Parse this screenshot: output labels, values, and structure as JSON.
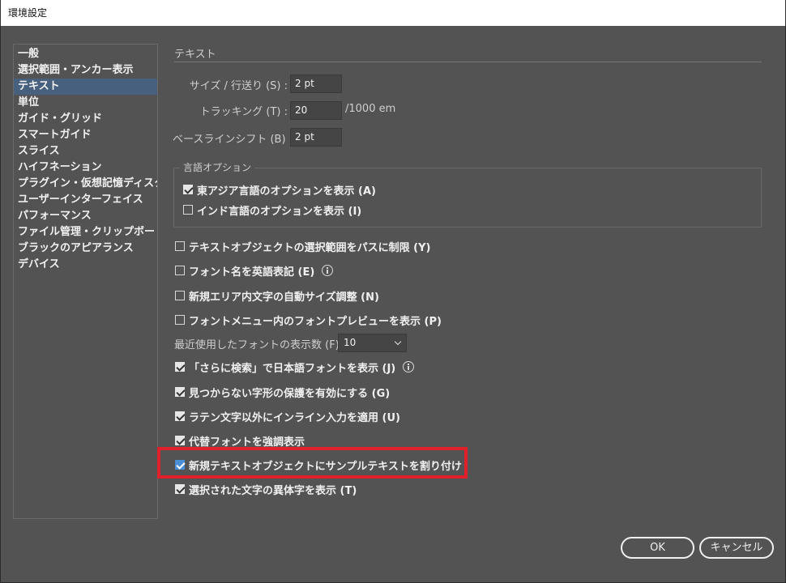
{
  "window": {
    "title": "環境設定"
  },
  "sidebar": {
    "items": [
      {
        "label": "一般",
        "selected": false
      },
      {
        "label": "選択範囲・アンカー表示",
        "selected": false
      },
      {
        "label": "テキスト",
        "selected": true
      },
      {
        "label": "単位",
        "selected": false
      },
      {
        "label": "ガイド・グリッド",
        "selected": false
      },
      {
        "label": "スマートガイド",
        "selected": false
      },
      {
        "label": "スライス",
        "selected": false
      },
      {
        "label": "ハイフネーション",
        "selected": false
      },
      {
        "label": "プラグイン・仮想記憶ディスク",
        "selected": false
      },
      {
        "label": "ユーザーインターフェイス",
        "selected": false
      },
      {
        "label": "パフォーマンス",
        "selected": false
      },
      {
        "label": "ファイル管理・クリップボード",
        "selected": false
      },
      {
        "label": "ブラックのアピアランス",
        "selected": false
      },
      {
        "label": "デバイス",
        "selected": false
      }
    ]
  },
  "text": {
    "section_title": "テキスト",
    "size_label": "サイズ / 行送り (S) :",
    "size_value": "2 pt",
    "tracking_label": "トラッキング (T) :",
    "tracking_value": "20",
    "tracking_unit": "/1000 em",
    "baseline_label": "ベースラインシフト (B) :",
    "baseline_value": "2 pt",
    "lang_group_title": "言語オプション",
    "east_asian": {
      "label": "東アジア言語のオプションを表示 (A)",
      "checked": true
    },
    "indic": {
      "label": "インド言語のオプションを表示 (I)",
      "checked": false
    },
    "options": [
      {
        "label": "テキストオブジェクトの選択範囲をパスに制限 (Y)",
        "checked": false
      },
      {
        "label": "フォント名を英語表記 (E)",
        "checked": false,
        "info": true
      },
      {
        "label": "新規エリア内文字の自動サイズ調整 (N)",
        "checked": false
      },
      {
        "label": "フォントメニュー内のフォントプレビューを表示 (P)",
        "checked": false
      }
    ],
    "recent_fonts_label": "最近使用したフォントの表示数 (F) :",
    "recent_fonts_value": "10",
    "options2": [
      {
        "label": "「さらに検索」で日本語フォントを表示 (J)",
        "checked": true,
        "info": true
      },
      {
        "label": "見つからない字形の保護を有効にする (G)",
        "checked": true
      },
      {
        "label": "ラテン文字以外にインライン入力を適用 (U)",
        "checked": true
      },
      {
        "label": "代替フォントを強調表示",
        "checked": true
      },
      {
        "label": "新規テキストオブジェクトにサンプルテキストを割り付け",
        "checked": true
      },
      {
        "label": "選択された文字の異体字を表示 (T)",
        "checked": true
      }
    ]
  },
  "buttons": {
    "ok": "OK",
    "cancel": "キャンセル"
  },
  "colors": {
    "background": "#535353",
    "selection": "#46607e",
    "highlight": "#e0202a"
  }
}
